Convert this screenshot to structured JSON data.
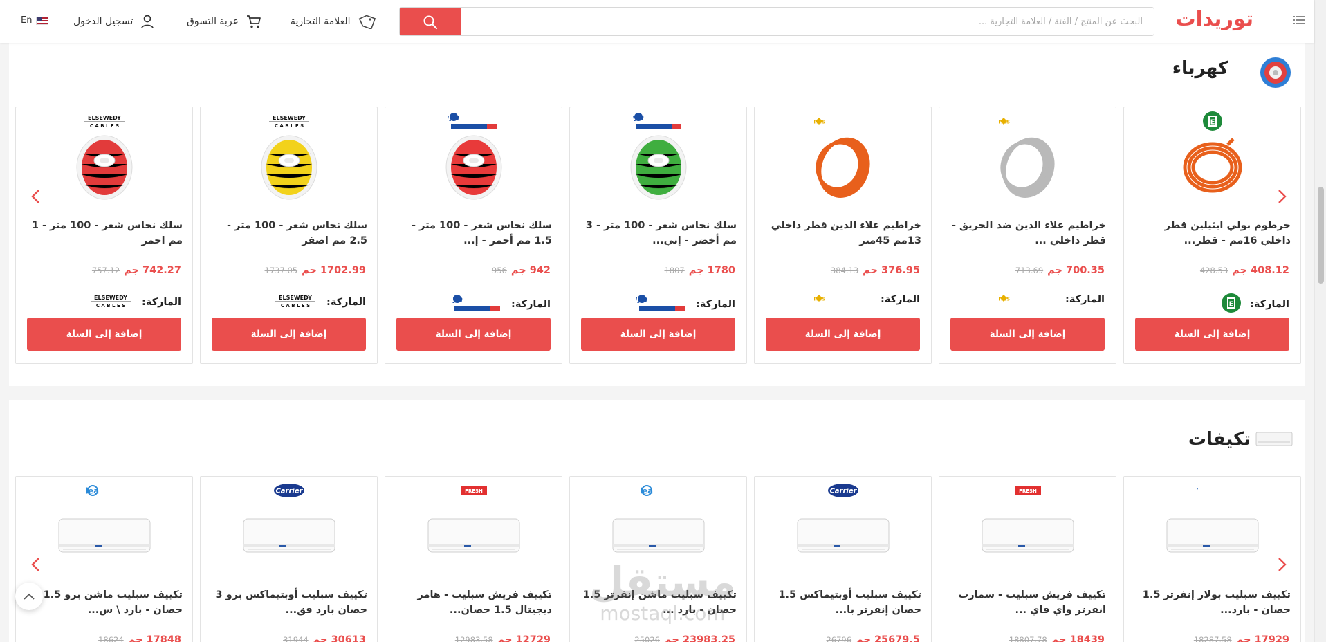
{
  "header": {
    "logo": "توريدات",
    "search_placeholder": "البحث عن المنتج / الفئة / العلامة التجارية ...",
    "brand_label": "العلامة التجارية",
    "cart_label": "عربة التسوق",
    "login_label": "تسجيل الدخول",
    "language": "En"
  },
  "sections": [
    {
      "title": "كهرباء",
      "brand_label": "الماركة:",
      "add_label": "إضافة إلى السلة",
      "products": [
        {
          "name": "خرطوم بولي ايثيلين قطر داخلي 16مم - قطر...",
          "price": "408.12 جم",
          "old_price": "428.53",
          "brand": "E",
          "color": "#e8601c"
        },
        {
          "name": "خراطيم علاء الدين ضد الحريق - قطر داخلي ...",
          "price": "700.35 جم",
          "old_price": "713.69",
          "brand": "ALAA ELDIN PLASTICS",
          "color": "#b9b9b9"
        },
        {
          "name": "خراطيم علاء الدين قطر داخلي 13مم 45متر",
          "price": "376.95 جم",
          "old_price": "384.13",
          "brand": "ALAA ELDIN PLASTICS",
          "color": "#e8601c"
        },
        {
          "name": "سلك نحاس شعر - 100 متر - 3 مم أخضر - إني...",
          "price": "1780 جم",
          "old_price": "1807",
          "brand": "energya",
          "color": "#3fae3f"
        },
        {
          "name": "سلك نحاس شعر - 100 متر - 1.5 مم أحمر - إ...",
          "price": "942 جم",
          "old_price": "956",
          "brand": "energya",
          "color": "#e83a3a"
        },
        {
          "name": "سلك نحاس شعر - 100 متر - 2.5 مم اصفر",
          "price": "1702.99 جم",
          "old_price": "1737.05",
          "brand": "ELSEWEDY CABLES",
          "color": "#f2d21b"
        },
        {
          "name": "سلك نحاس شعر - 100 متر - 1 مم احمر",
          "price": "742.27 جم",
          "old_price": "757.12",
          "brand": "ELSEWEDY CABLES",
          "color": "#e23b3b"
        }
      ]
    },
    {
      "title": "تكيفات",
      "products": [
        {
          "name": "تكييف سبليت بولار إنفرتر 1.5 حصان - بارد...",
          "price": "17929 جم",
          "old_price": "18287.58",
          "brand": "GREE"
        },
        {
          "name": "تكييف فريش سبليت - سمارت انفرتر واي فاي ...",
          "price": "18439 جم",
          "old_price": "18807.78",
          "brand": "FRESH"
        },
        {
          "name": "تكييف سبليت أوبتيماكس 1.5 حصان إنفرتر با...",
          "price": "25679.5 جم",
          "old_price": "26796",
          "brand": "Carrier"
        },
        {
          "name": "تكييف سبليت ماشن إنفرتر 1.5 حصان - بارد ...",
          "price": "23983.25 جم",
          "old_price": "25026",
          "brand": "Midea"
        },
        {
          "name": "تكييف فريش سبليت - هامر ديجيتال 1.5 حصان...",
          "price": "12729 جم",
          "old_price": "12983.58",
          "brand": "FRESH"
        },
        {
          "name": "تكييف سبليت أوبتيماكس برو 3 حصان بارد فق...",
          "price": "30613 جم",
          "old_price": "31944",
          "brand": "Carrier"
        },
        {
          "name": "تكييف سبليت ماشن برو 1.5 حصان - بارد \\ س...",
          "price": "17848 جم",
          "old_price": "18624",
          "brand": "Midea"
        }
      ]
    }
  ],
  "watermark": {
    "ar": "مستقل",
    "en": "mostaql.com"
  },
  "colors": {
    "accent": "#ea4e4d"
  }
}
